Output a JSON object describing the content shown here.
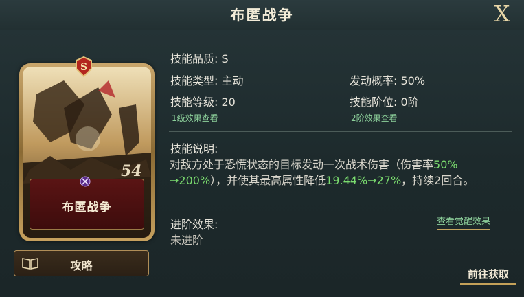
{
  "dialog": {
    "title": "布匿战争",
    "close_label": "X"
  },
  "card": {
    "name": "布匿战争",
    "rank": "S",
    "art_overlay_text": "54"
  },
  "strategy_button": {
    "label": "攻略"
  },
  "skill": {
    "quality_label": "技能品质: S",
    "type_label": "技能类型: 主动",
    "trigger_label": "发动概率: 50%",
    "level_label": "技能等级: 20",
    "stage_label": "技能阶位: 0阶",
    "level1_link": "1级效果查看",
    "stage2_link": "2阶效果查看",
    "desc_title": "技能说明:",
    "desc_part1": "对敌方处于恐慌状态的目标发动一次战术伤害（伤害率",
    "desc_val1": "50%",
    "desc_val2": "→200%",
    "desc_part2": "），并使其最高属性降低",
    "desc_val3": "19.44%→27%",
    "desc_part3": "，持续2回合。",
    "advance_title": "进阶效果:",
    "advance_value": "未进阶",
    "awaken_link": "查看觉醒效果"
  },
  "get_button": {
    "label": "前往获取"
  },
  "colors": {
    "highlight_green": "#7bdc6f",
    "gold_accent": "#c6a55f",
    "panel_bg": "#1e2a2c"
  }
}
